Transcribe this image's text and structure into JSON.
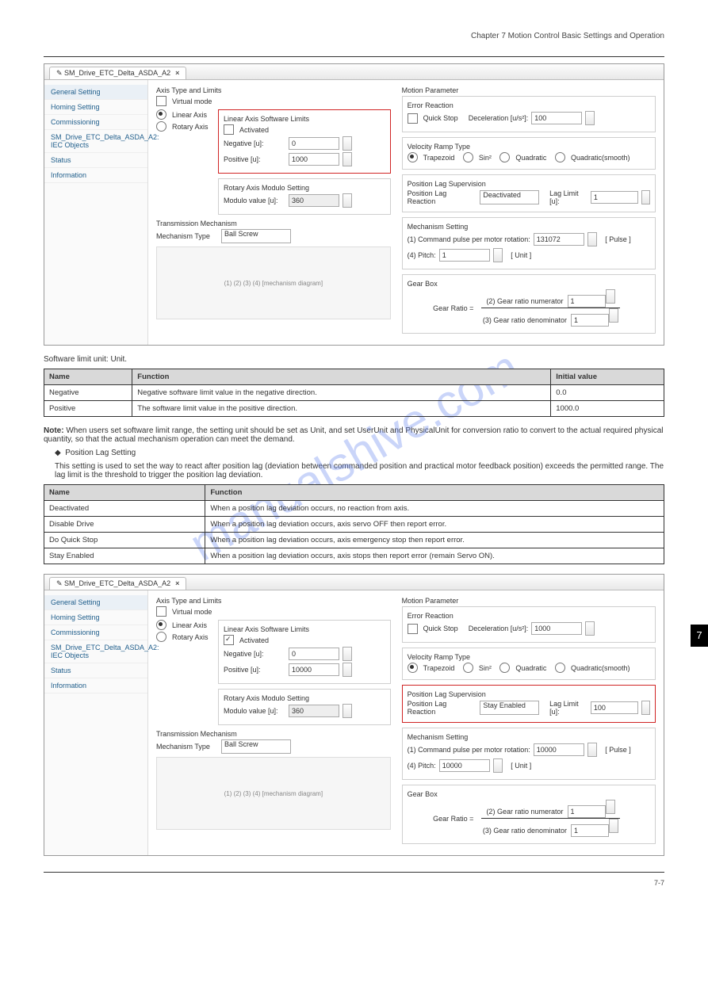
{
  "header": {
    "chapter": "Chapter 7   Motion Control Basic Settings and Operation",
    "rightnum": ""
  },
  "app": {
    "tab": "SM_Drive_ETC_Delta_ASDA_A2",
    "sidebar": [
      "General Setting",
      "Homing Setting",
      "Commissioning",
      "SM_Drive_ETC_Delta_ASDA_A2: IEC Objects",
      "Status",
      "Information"
    ],
    "axis": {
      "title": "Axis Type and Limits",
      "virtual": "Virtual mode",
      "linear": "Linear Axis",
      "rotary": "Rotary Axis"
    },
    "swlim": {
      "title": "Linear Axis Software Limits",
      "activated": "Activated",
      "neg": "Negative [u]:",
      "negv": "0",
      "pos": "Positive [u]:",
      "posv1": "1000",
      "posv2": "10000"
    },
    "modulo": {
      "title": "Rotary Axis Modulo Setting",
      "label": "Modulo value [u]:",
      "val": "360"
    },
    "motion": {
      "title": "Motion Parameter",
      "err": "Error Reaction",
      "quick": "Quick Stop",
      "decel": "Deceleration [u/s²]:",
      "decelv1": "100",
      "decelv2": "1000",
      "ramp": "Velocity Ramp Type",
      "r1": "Trapezoid",
      "r2": "Sin²",
      "r3": "Quadratic",
      "r4": "Quadratic(smooth)"
    },
    "lag": {
      "title": "Position Lag Supervision",
      "react": "Position Lag Reaction",
      "opt1": "Deactivated",
      "opt2": "Stay Enabled",
      "laglim": "Lag Limit [u]:",
      "limv1": "1",
      "limv2": "100"
    },
    "trans": {
      "title": "Transmission Mechanism",
      "mtype": "Mechanism Type",
      "mval": "Ball Screw",
      "diagram": "(1) (2) (3) (4)  [mechanism diagram]"
    },
    "mech": {
      "title": "Mechanism Setting",
      "p1": "(1) Command pulse per motor rotation:",
      "p1v1": "131072",
      "p1v2": "10000",
      "pulse": "[ Pulse ]",
      "p4": "(4) Pitch:",
      "p4v1": "1",
      "p4v2": "10000",
      "unit": "[ Unit ]"
    },
    "gear": {
      "title": "Gear Box",
      "label": "Gear Ratio  =",
      "top": "(2) Gear ratio numerator",
      "topv": "1",
      "bot": "(3) Gear ratio denominator",
      "botv": "1"
    }
  },
  "table1": {
    "h": [
      "Name",
      "Function",
      "Initial value"
    ],
    "r1": [
      "Negative",
      "Negative software limit value in the negative direction.",
      "0.0"
    ],
    "r2": [
      "Positive",
      "The software limit value in the positive direction.",
      "1000.0"
    ]
  },
  "text": {
    "swUnit": "Software limit unit: Unit.",
    "noteLead": "Note:",
    "noteBody": "When users set software limit range, the setting unit should be set as Unit, and set UserUnit and PhysicalUnit for conversion ratio to convert to the actual required physical quantity, so that the actual mechanism operation can meet the demand.",
    "lagHeading": "Position Lag Setting",
    "lagBody": "This setting is used to set the way to react after position lag (deviation between commanded position and practical motor feedback position) exceeds the permitted range. The lag limit is the threshold to trigger the position lag deviation."
  },
  "table2": {
    "h": [
      "Name",
      "Function"
    ],
    "r1": [
      "Deactivated",
      "When a position lag deviation occurs, no reaction from axis."
    ],
    "r2": [
      "Disable Drive",
      "When a position lag deviation occurs, axis servo OFF then report error."
    ],
    "r3": [
      "Do Quick Stop",
      "When a position lag deviation occurs, axis emergency stop then report error."
    ],
    "r4": [
      "Stay Enabled",
      "When a position lag deviation occurs, axis stops then report error (remain Servo ON)."
    ]
  },
  "footer": {
    "left": "",
    "right": "7-7"
  },
  "sidenum": "7"
}
